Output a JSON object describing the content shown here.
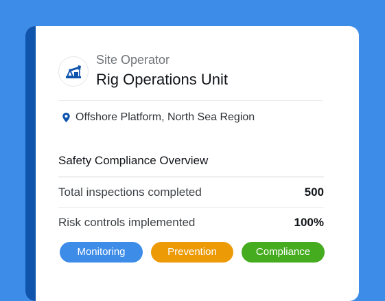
{
  "colors": {
    "background": "#3d8ce8",
    "card": "#ffffff",
    "accent_bar": "#0f55ae",
    "monitoring": "#3d8ce8",
    "prevention": "#ec9a06",
    "compliance": "#45ac1f"
  },
  "header": {
    "subtitle": "Site Operator",
    "title": "Rig Operations Unit",
    "logo_icon": "oil-pump-icon"
  },
  "location": {
    "icon": "map-pin-icon",
    "text": "Offshore Platform, North Sea Region"
  },
  "section": {
    "title": "Safety Compliance Overview",
    "stats": [
      {
        "label": "Total inspections completed",
        "value": "500"
      },
      {
        "label": "Risk controls implemented",
        "value": "100%"
      }
    ]
  },
  "tags": [
    {
      "label": "Monitoring"
    },
    {
      "label": "Prevention"
    },
    {
      "label": "Compliance"
    }
  ]
}
